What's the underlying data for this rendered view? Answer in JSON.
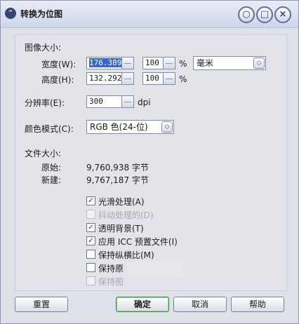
{
  "window": {
    "title": "转换为位图",
    "title_icon": "chevron-icon",
    "buttons": {
      "minimize": "○",
      "maximize": "□",
      "close": "×"
    }
  },
  "image_size": {
    "section_label": "图像大小:",
    "width": {
      "label": "宽度(W):",
      "value": "176.389",
      "percent": "100",
      "percent_unit": "%"
    },
    "height": {
      "label": "高度(H):",
      "value": "132.292",
      "percent": "100",
      "percent_unit": "%"
    },
    "units": {
      "selected": "毫米"
    }
  },
  "resolution": {
    "label": "分辨率(E):",
    "value": "300",
    "unit": "dpi"
  },
  "color_mode": {
    "label": "颜色模式(C):",
    "selected": "RGB 色(24-位)"
  },
  "file_size": {
    "section_label": "文件大小:",
    "original": {
      "label": "原始:",
      "value": "9,760,938 字节"
    },
    "new": {
      "label": "新建:",
      "value": "9,767,187 字节"
    }
  },
  "options": [
    {
      "label": "光滑处理(A)",
      "checked": true,
      "enabled": true
    },
    {
      "label": "抖动处理的(D)",
      "checked": false,
      "enabled": false
    },
    {
      "label": "透明背景(T)",
      "checked": true,
      "enabled": true
    },
    {
      "label": "应用 ICC 预置文件(I)",
      "checked": true,
      "enabled": true
    },
    {
      "label": "保持纵横比(M)",
      "checked": false,
      "enabled": true
    },
    {
      "label": "保持原",
      "checked": false,
      "enabled": true
    },
    {
      "label": "保持图",
      "checked": false,
      "enabled": false
    }
  ],
  "footer": {
    "reset": "重置",
    "ok": "确定",
    "cancel": "取消",
    "help": "帮助"
  },
  "colors": {
    "accent": "#3966c8",
    "ok_border": "#3b8f3b"
  }
}
